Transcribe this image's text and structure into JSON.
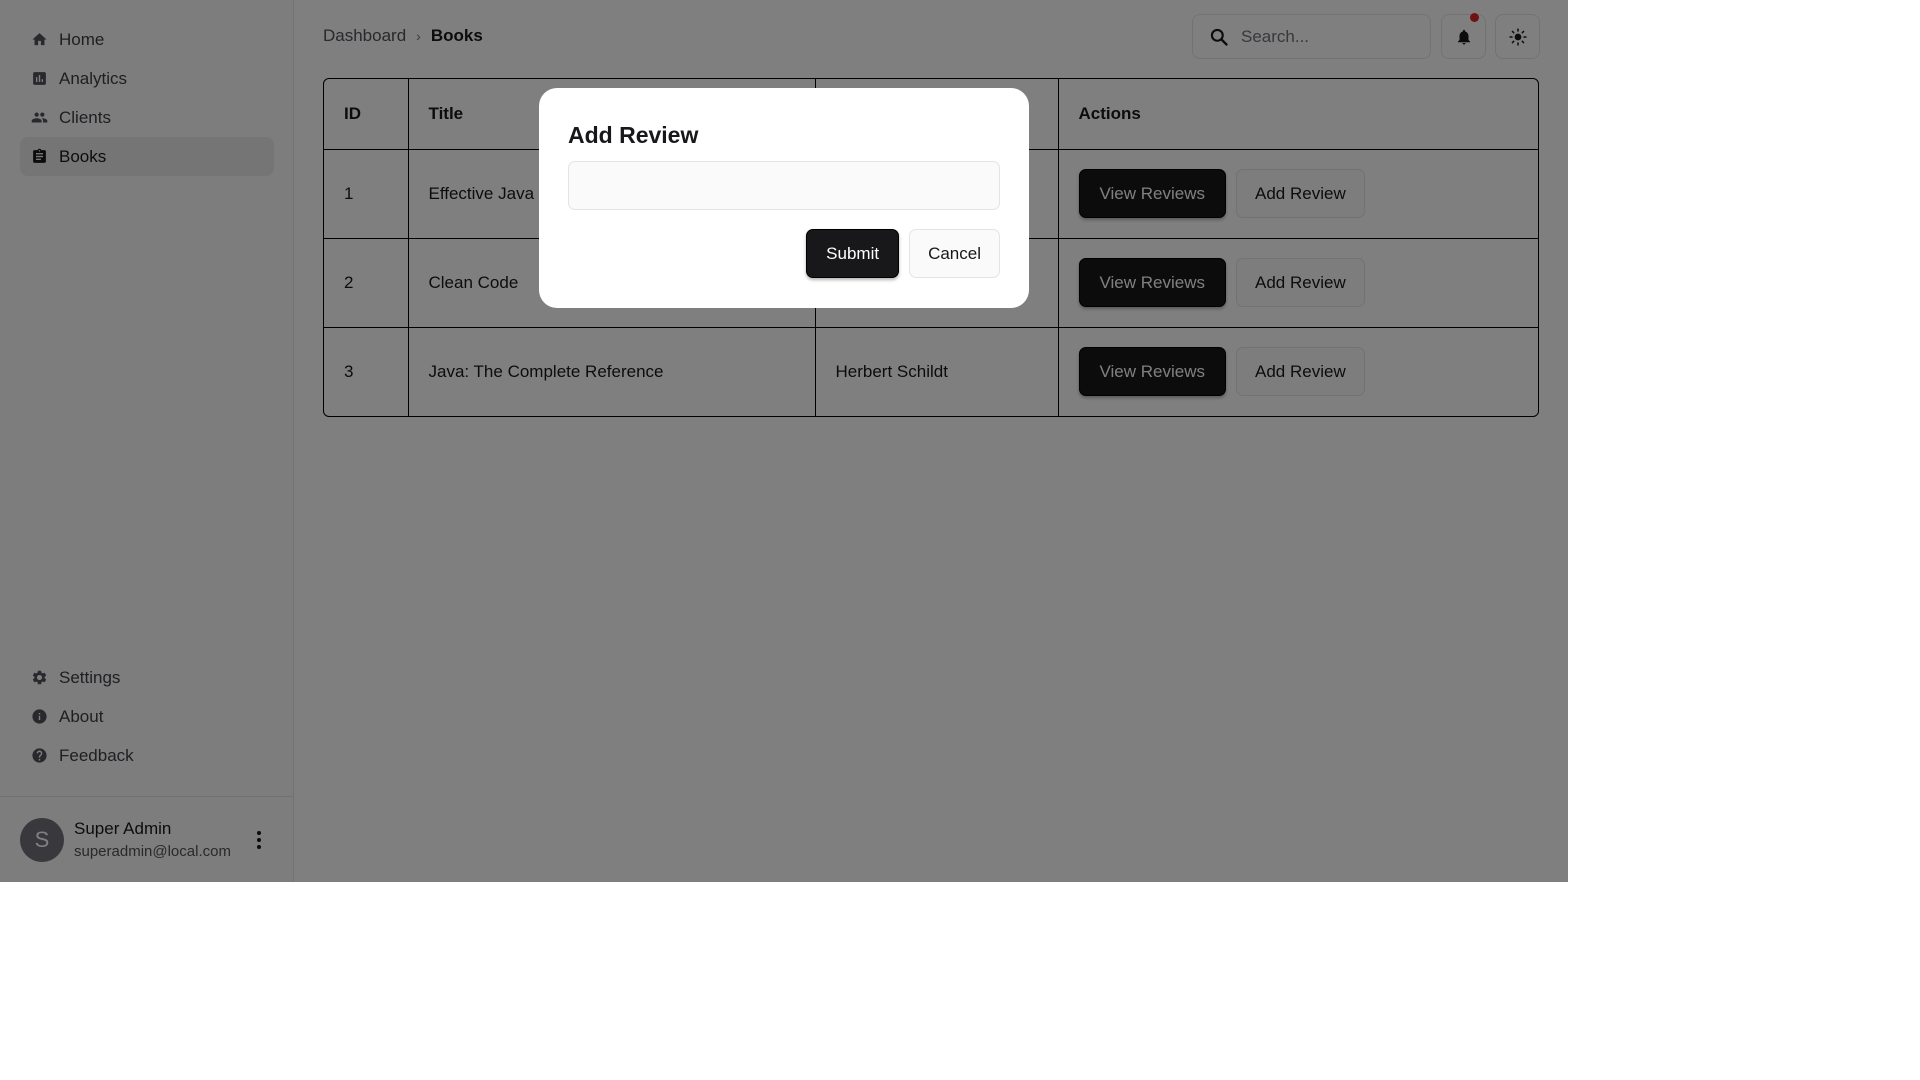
{
  "sidebar": {
    "nav": [
      {
        "label": "Home",
        "icon": "home-icon"
      },
      {
        "label": "Analytics",
        "icon": "analytics-icon"
      },
      {
        "label": "Clients",
        "icon": "people-icon"
      },
      {
        "label": "Books",
        "icon": "clipboard-icon",
        "active": true
      }
    ],
    "bottom_nav": [
      {
        "label": "Settings",
        "icon": "gear-icon"
      },
      {
        "label": "About",
        "icon": "info-icon"
      },
      {
        "label": "Feedback",
        "icon": "help-icon"
      }
    ],
    "user": {
      "initial": "S",
      "name": "Super Admin",
      "email": "superadmin@local.com"
    }
  },
  "header": {
    "breadcrumb": {
      "parent": "Dashboard",
      "current": "Books"
    },
    "search": {
      "placeholder": "Search..."
    },
    "notification_dot_color": "#dc2626"
  },
  "table": {
    "columns": [
      "ID",
      "Title",
      "",
      "Actions"
    ],
    "rows": [
      {
        "id": "1",
        "title": "Effective Java",
        "author": "",
        "view_label": "View Reviews",
        "add_label": "Add Review"
      },
      {
        "id": "2",
        "title": "Clean Code",
        "author": "",
        "view_label": "View Reviews",
        "add_label": "Add Review"
      },
      {
        "id": "3",
        "title": "Java: The Complete Reference",
        "author": "Herbert Schildt",
        "view_label": "View Reviews",
        "add_label": "Add Review"
      }
    ]
  },
  "modal": {
    "title": "Add Review",
    "input_value": "",
    "submit_label": "Submit",
    "cancel_label": "Cancel"
  },
  "colors": {
    "primary_button": "#18181b",
    "overlay": "rgba(0,0,0,0.5)"
  }
}
